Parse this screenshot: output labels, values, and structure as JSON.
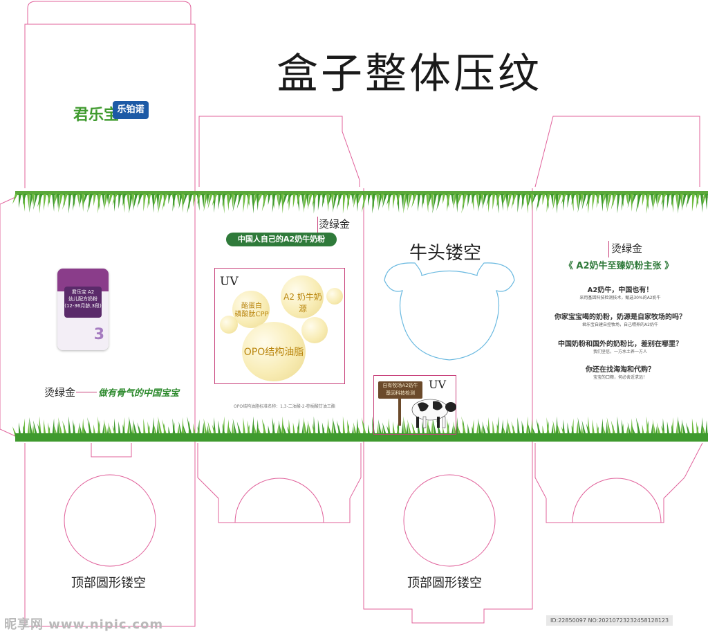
{
  "title": "盒子整体压纹",
  "top_flap_brand": {
    "logo_left": "君乐宝",
    "logo_right": "乐铂诺"
  },
  "panel1": {
    "can_top_text": "君乐宝 A2",
    "can_label": "幼儿配方奶粉",
    "can_sublabel": "(12-36月龄,3段)",
    "can_number": "3",
    "foil_label": "烫绿金",
    "slogan": "做有骨气的中国宝宝"
  },
  "panel2": {
    "foil_label": "烫绿金",
    "banner": "中国人自己的A2奶牛奶粉",
    "uv_label": "UV",
    "bubble1": "酪蛋白\n磷酸肽CPP",
    "bubble2": "A2 奶牛奶源",
    "bubble3": "OPO结构油脂",
    "footnote": "OPO结构油脂标准名称：1,3-二油酸-2-棕榈酸甘油三酯"
  },
  "panel3": {
    "cutout_label": "牛头镂空",
    "uv_label": "UV",
    "sign_line1": "自有牧场A2奶牛",
    "sign_line2": "基因科技检测"
  },
  "panel4": {
    "foil_label": "烫绿金",
    "headline": "《 A2奶牛至臻奶粉主张 》",
    "items": [
      {
        "h": "A2奶牛，中国也有！",
        "s": "采用基因科技检测技术，甄选30%的A2奶牛"
      },
      {
        "h": "你家宝宝喝的奶粉，奶源是自家牧场的吗？",
        "s": "君乐宝自建自控牧场，自己喂养的A2奶牛"
      },
      {
        "h": "中国奶粉和国外的奶粉比，差别在哪里？",
        "s": "我们坚信，一方水土养一方人"
      },
      {
        "h": "你还在找海淘和代购？",
        "s": "宝宝的口粮，何必舍近求远！"
      }
    ]
  },
  "bottom": {
    "label_left": "顶部圆形镂空",
    "label_right": "顶部圆形镂空"
  },
  "watermark": {
    "site": "昵享网 www.nipic.com",
    "id": "ID:22850097 NO:20210723232458128123"
  },
  "colors": {
    "dieline": "#e0609a",
    "grass": "#3f9a2e",
    "brand_green": "#2f7a3a",
    "brand_blue": "#1c5aa6",
    "uv_box": "#c8407a",
    "cow_outline": "#6ab9e0"
  }
}
